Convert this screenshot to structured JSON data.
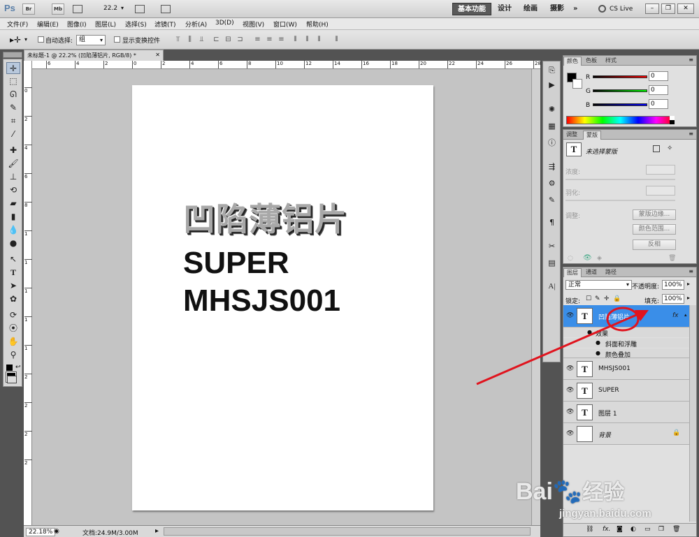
{
  "app": {
    "logo": "Ps",
    "br": "Br",
    "mb": "Mb",
    "zoom": "22.2"
  },
  "workspaces": [
    "基本功能",
    "设计",
    "绘画",
    "摄影",
    "»"
  ],
  "cs_live": "CS Live",
  "menu": [
    "文件(F)",
    "编辑(E)",
    "图像(I)",
    "图层(L)",
    "选择(S)",
    "滤镜(T)",
    "分析(A)",
    "3D(D)",
    "视图(V)",
    "窗口(W)",
    "帮助(H)"
  ],
  "options": {
    "auto_select_label": "自动选择:",
    "auto_select_value": "组",
    "show_transform_label": "显示变换控件"
  },
  "document": {
    "tab_title": "未标题-1 @ 22.2% (凹陷薄铝片, RGB/8) *",
    "text_emboss": "凹陷薄铝片",
    "text_super": "SUPER",
    "text_code": "MHSJS001"
  },
  "ruler_h": [
    "6",
    "4",
    "2",
    "0",
    "2",
    "4",
    "6",
    "8",
    "10",
    "12",
    "14",
    "16",
    "18",
    "20",
    "22",
    "24",
    "26",
    "28"
  ],
  "ruler_v": [
    "0",
    "2",
    "4",
    "6",
    "8",
    "1",
    "1",
    "1",
    "1",
    "1",
    "2",
    "2",
    "2",
    "2"
  ],
  "status": {
    "zoom": "22.18%",
    "doc": "文档:24.9M/3.00M"
  },
  "color_panel": {
    "tabs": [
      "颜色",
      "色板",
      "样式"
    ],
    "r_label": "R",
    "g_label": "G",
    "b_label": "B",
    "r": "0",
    "g": "0",
    "b": "0"
  },
  "adjust_panel": {
    "tabs": [
      "调整",
      "蒙版"
    ],
    "no_mask": "未选择蒙版",
    "density": "浓度:",
    "feather": "羽化:",
    "refine": "调整:",
    "mask_edge": "蒙版边缘...",
    "color_range": "颜色范围...",
    "invert": "反相"
  },
  "layers_panel": {
    "tabs": [
      "图层",
      "通道",
      "路径"
    ],
    "blend": "正常",
    "opacity_label": "不透明度:",
    "opacity": "100%",
    "lock_label": "锁定:",
    "fill_label": "填充:",
    "fill": "100%",
    "layers": [
      {
        "name": "凹陷薄铝片",
        "thumb": "T"
      },
      {
        "name": "MHSJS001",
        "thumb": "T"
      },
      {
        "name": "SUPER",
        "thumb": "T"
      },
      {
        "name": "图层 1",
        "thumb": "T"
      },
      {
        "name": "背景",
        "thumb": ""
      }
    ],
    "effects_label": "效果",
    "effect1": "斜面和浮雕",
    "effect2": "颜色叠加",
    "fx": "fx"
  },
  "watermark": {
    "brand": "Bai",
    "brand2": "经验",
    "url": "jingyan.baidu.com"
  },
  "colors": {
    "annotation": "#e0141e",
    "selected_layer": "#3a8ee8"
  }
}
